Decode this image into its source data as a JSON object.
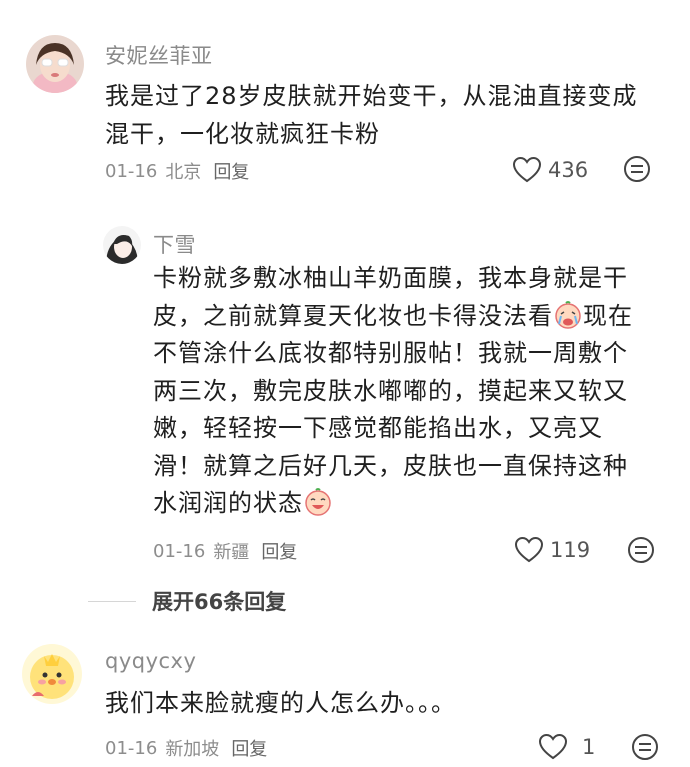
{
  "comments": [
    {
      "username": "安妮丝菲亚",
      "text": "我是过了28岁皮肤就开始变干，从混油直接变成混干，一化妆就疯狂卡粉",
      "date": "01-16",
      "location": "北京",
      "reply_label": "回复",
      "likes": "436"
    },
    {
      "username": "下雪",
      "text_part1": "卡粉就多敷冰柚山羊奶面膜，我本身就是干皮，之前就算夏天化妆也卡得没法看",
      "text_part2": "现在不管涂什么底妆都特别服帖！我就一周敷个两三次，敷完皮肤水嘟嘟的，摸起来又软又嫩，轻轻按一下感觉都能掐出水，又亮又滑！就算之后好几天，皮肤也一直保持这种水润润的状态",
      "date": "01-16",
      "location": "新疆",
      "reply_label": "回复",
      "likes": "119"
    },
    {
      "username": "qyqycxy",
      "text": "我们本来脸就瘦的人怎么办。。。",
      "date": "01-16",
      "location": "新加坡",
      "reply_label": "回复",
      "likes": "1"
    }
  ],
  "expand_replies": "展开66条回复",
  "icons": {
    "like": "heart-outline-icon",
    "more": "more-options-icon",
    "emoji_cry": "crying-face-emoji",
    "emoji_laugh": "laughing-face-emoji"
  },
  "colors": {
    "text": "#1f1f1f",
    "meta": "#8d8d8d",
    "username": "#8a8a8a"
  }
}
